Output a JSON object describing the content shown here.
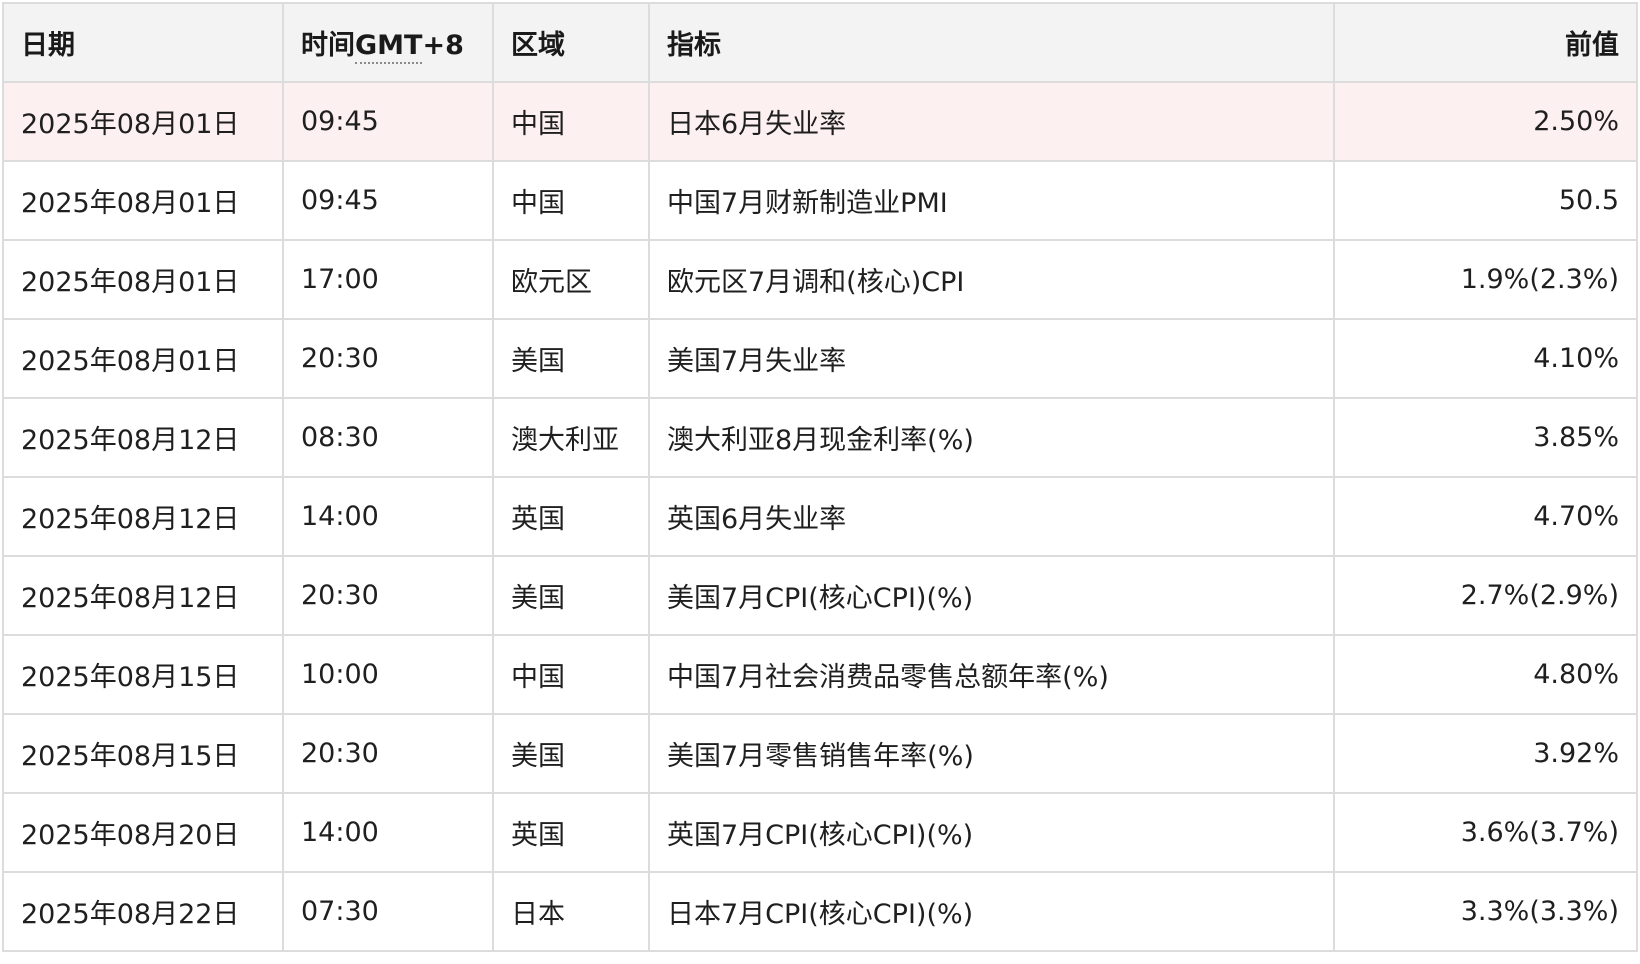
{
  "columns": {
    "date": "日期",
    "time_prefix": "时间",
    "time_tz": "GMT",
    "time_suffix": "+8",
    "region": "区域",
    "indicator": "指标",
    "previous": "前值"
  },
  "rows": [
    {
      "date": "2025年08月01日",
      "time": "09:45",
      "region": "中国",
      "indicator": "日本6月失业率",
      "previous": "2.50%",
      "highlighted": true
    },
    {
      "date": "2025年08月01日",
      "time": "09:45",
      "region": "中国",
      "indicator": "中国7月财新制造业PMI",
      "previous": "50.5"
    },
    {
      "date": "2025年08月01日",
      "time": "17:00",
      "region": "欧元区",
      "indicator": "欧元区7月调和(核心)CPI",
      "previous": "1.9%(2.3%)"
    },
    {
      "date": "2025年08月01日",
      "time": "20:30",
      "region": "美国",
      "indicator": "美国7月失业率",
      "previous": "4.10%"
    },
    {
      "date": "2025年08月12日",
      "time": "08:30",
      "region": "澳大利亚",
      "indicator": "澳大利亚8月现金利率(%)",
      "previous": "3.85%"
    },
    {
      "date": "2025年08月12日",
      "time": "14:00",
      "region": "英国",
      "indicator": "英国6月失业率",
      "previous": "4.70%"
    },
    {
      "date": "2025年08月12日",
      "time": "20:30",
      "region": "美国",
      "indicator": "美国7月CPI(核心CPI)(%)",
      "previous": "2.7%(2.9%)"
    },
    {
      "date": "2025年08月15日",
      "time": "10:00",
      "region": "中国",
      "indicator": "中国7月社会消费品零售总额年率(%)",
      "previous": "4.80%"
    },
    {
      "date": "2025年08月15日",
      "time": "20:30",
      "region": "美国",
      "indicator": "美国7月零售销售年率(%)",
      "previous": "3.92%"
    },
    {
      "date": "2025年08月20日",
      "time": "14:00",
      "region": "英国",
      "indicator": "英国7月CPI(核心CPI)(%)",
      "previous": "3.6%(3.7%)"
    },
    {
      "date": "2025年08月22日",
      "time": "07:30",
      "region": "日本",
      "indicator": "日本7月CPI(核心CPI)(%)",
      "previous": "3.3%(3.3%)"
    }
  ]
}
